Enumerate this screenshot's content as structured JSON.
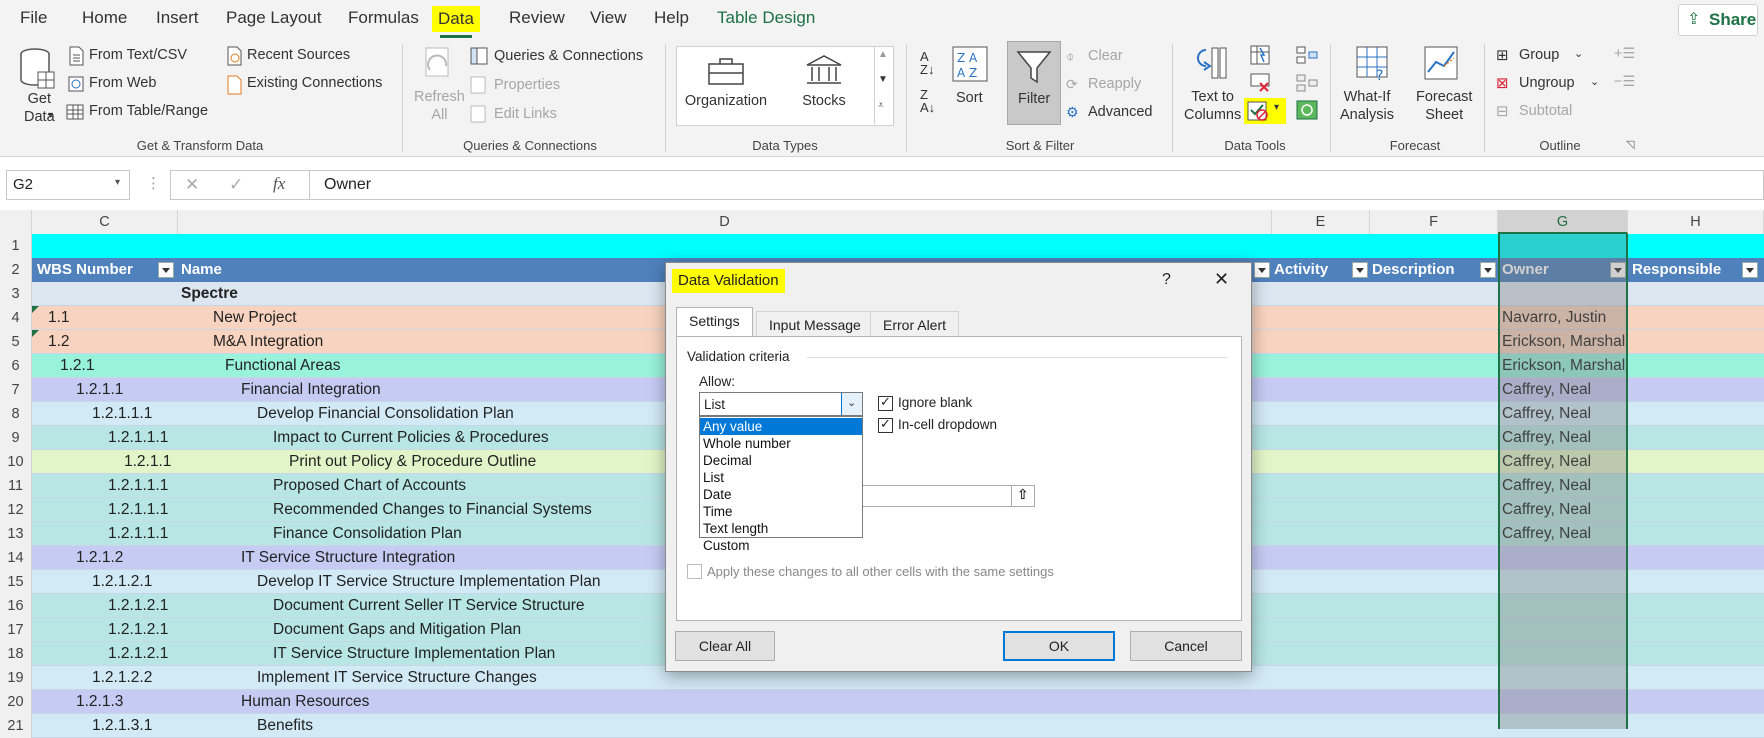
{
  "menu": {
    "tabs": [
      "File",
      "Home",
      "Insert",
      "Page Layout",
      "Formulas",
      "Data",
      "Review",
      "View",
      "Help",
      "Table Design"
    ],
    "active_tab": "Data",
    "share_label": "Share"
  },
  "ribbon": {
    "get_transform": {
      "get_data": "Get\nData",
      "from_text_csv": "From Text/CSV",
      "from_web": "From Web",
      "from_table_range": "From Table/Range",
      "recent_sources": "Recent Sources",
      "existing_connections": "Existing Connections",
      "group_label": "Get & Transform Data"
    },
    "queries": {
      "refresh_all": "Refresh\nAll",
      "queries_connections": "Queries & Connections",
      "properties": "Properties",
      "edit_links": "Edit Links",
      "group_label": "Queries & Connections"
    },
    "data_types": {
      "organization": "Organization",
      "stocks": "Stocks",
      "group_label": "Data Types"
    },
    "sort_filter": {
      "sort": "Sort",
      "filter": "Filter",
      "clear": "Clear",
      "reapply": "Reapply",
      "advanced": "Advanced",
      "group_label": "Sort & Filter"
    },
    "data_tools": {
      "text_to_columns": "Text to\nColumns",
      "group_label": "Data Tools"
    },
    "forecast": {
      "what_if": "What-If\nAnalysis",
      "forecast_sheet": "Forecast\nSheet",
      "group_label": "Forecast"
    },
    "outline": {
      "group": "Group",
      "ungroup": "Ungroup",
      "subtotal": "Subtotal",
      "group_label": "Outline"
    }
  },
  "formula_bar": {
    "name_box": "G2",
    "fx": "fx",
    "content": "Owner"
  },
  "columns": [
    "C",
    "D",
    "E",
    "F",
    "G",
    "H"
  ],
  "row_numbers": [
    "1",
    "2",
    "3",
    "4",
    "5",
    "6",
    "7",
    "8",
    "9",
    "10",
    "11",
    "12",
    "13",
    "14",
    "15",
    "16",
    "17",
    "18",
    "19",
    "20",
    "21"
  ],
  "header_row": {
    "wbs": "WBS Number",
    "name": "Name",
    "activity": "Activity",
    "description": "Description",
    "owner": "Owner",
    "responsible": "Responsible"
  },
  "rows": [
    {
      "wbs": "",
      "name": "Spectre",
      "owner": "",
      "level": 0,
      "color": "#dce6f1"
    },
    {
      "wbs": "1.1",
      "name": "New Project",
      "owner": "Navarro, Justin",
      "level": 1,
      "color": "#f8d3bf"
    },
    {
      "wbs": "1.2",
      "name": "M&A Integration",
      "owner": "Erickson, Marshall",
      "level": 1,
      "color": "#f8d3bf"
    },
    {
      "wbs": "1.2.1",
      "name": "Functional Areas",
      "owner": "Erickson, Marshall",
      "level": 2,
      "color": "#98f2dc"
    },
    {
      "wbs": "1.2.1.1",
      "name": "Financial Integration",
      "owner": "Caffrey, Neal",
      "level": 3,
      "color": "#c6cbf4"
    },
    {
      "wbs": "1.2.1.1.1",
      "name": "Develop Financial Consolidation Plan",
      "owner": "Caffrey, Neal",
      "level": 4,
      "color": "#d2eaf6"
    },
    {
      "wbs": "1.2.1.1.1",
      "name": "Impact to Current Policies & Procedures",
      "owner": "Caffrey, Neal",
      "level": 5,
      "color": "#b7e6e4"
    },
    {
      "wbs": "1.2.1.1",
      "name": "Print out Policy & Procedure Outline",
      "owner": "Caffrey, Neal",
      "level": 6,
      "color": "#e2f5c8"
    },
    {
      "wbs": "1.2.1.1.1",
      "name": "Proposed Chart of Accounts",
      "owner": "Caffrey, Neal",
      "level": 5,
      "color": "#b7e6e4"
    },
    {
      "wbs": "1.2.1.1.1",
      "name": "Recommended Changes to Financial Systems",
      "owner": "Caffrey, Neal",
      "level": 5,
      "color": "#b7e6e4"
    },
    {
      "wbs": "1.2.1.1.1",
      "name": "Finance Consolidation Plan",
      "owner": "Caffrey, Neal",
      "level": 5,
      "color": "#b7e6e4"
    },
    {
      "wbs": "1.2.1.2",
      "name": "IT Service Structure Integration",
      "owner": "",
      "level": 3,
      "color": "#c6cbf4"
    },
    {
      "wbs": "1.2.1.2.1",
      "name": "Develop IT Service Structure Implementation Plan",
      "owner": "",
      "level": 4,
      "color": "#d2eaf6"
    },
    {
      "wbs": "1.2.1.2.1",
      "name": "Document Current Seller IT Service Structure",
      "owner": "",
      "level": 5,
      "color": "#b7e6e4"
    },
    {
      "wbs": "1.2.1.2.1",
      "name": "Document Gaps and Mitigation Plan",
      "owner": "",
      "level": 5,
      "color": "#b7e6e4"
    },
    {
      "wbs": "1.2.1.2.1",
      "name": "IT Service Structure Implementation Plan",
      "owner": "",
      "level": 5,
      "color": "#b7e6e4"
    },
    {
      "wbs": "1.2.1.2.2",
      "name": "Implement IT Service Structure Changes",
      "owner": "",
      "level": 4,
      "color": "#d2eaf6"
    },
    {
      "wbs": "1.2.1.3",
      "name": "Human Resources",
      "owner": "",
      "level": 3,
      "color": "#c6cbf4"
    },
    {
      "wbs": "1.2.1.3.1",
      "name": "Benefits",
      "owner": "",
      "level": 4,
      "color": "#d2eaf6"
    }
  ],
  "dialog": {
    "title": "Data Validation",
    "help": "?",
    "close": "✕",
    "tabs": [
      "Settings",
      "Input Message",
      "Error Alert"
    ],
    "active_tab": "Settings",
    "section": "Validation criteria",
    "allow_label": "Allow:",
    "allow_value": "List",
    "allow_options": [
      "Any value",
      "Whole number",
      "Decimal",
      "List",
      "Date",
      "Time",
      "Text length",
      "Custom"
    ],
    "highlighted_option": "Any value",
    "ignore_blank": "Ignore blank",
    "in_cell_dropdown": "In-cell dropdown",
    "apply_all": "Apply these changes to all other cells with the same settings",
    "clear_all": "Clear All",
    "ok": "OK",
    "cancel": "Cancel"
  },
  "colors": {
    "excel_green": "#1e7145",
    "header_blue": "#4f81bd",
    "title_row": "#00ffff",
    "highlight_yellow": "#ffff00",
    "selection_blue": "#0078d7"
  }
}
